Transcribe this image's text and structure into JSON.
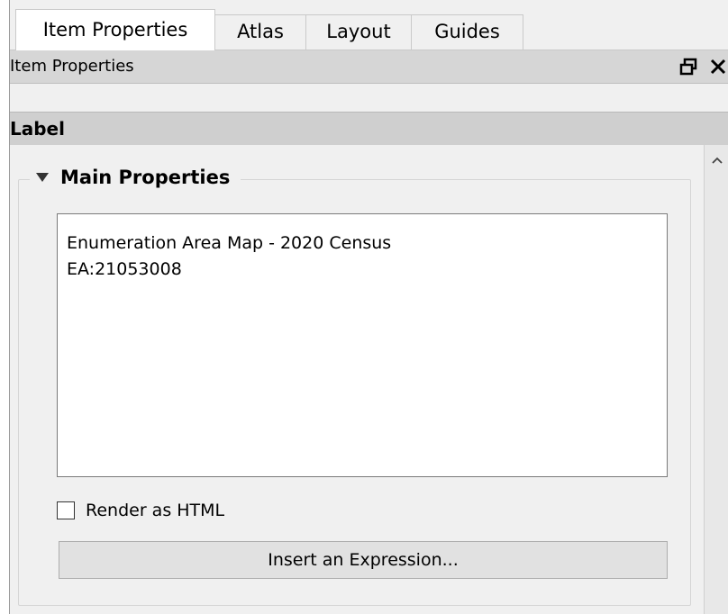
{
  "tabs": [
    {
      "label": "Item Properties",
      "active": true
    },
    {
      "label": "Atlas",
      "active": false
    },
    {
      "label": "Layout",
      "active": false
    },
    {
      "label": "Guides",
      "active": false
    }
  ],
  "dock": {
    "title": "Item Properties",
    "float_icon": "restore-window-icon",
    "close_icon": "close-icon"
  },
  "section": {
    "title": "Label"
  },
  "main_properties": {
    "title": "Main Properties",
    "collapse_icon": "triangle-down-icon",
    "label_text": "Enumeration Area Map - 2020 Census\nEA:21053008",
    "render_html_label": "Render as HTML",
    "render_html_checked": false,
    "insert_expression_label": "Insert an Expression..."
  },
  "colors": {
    "panel_bg": "#f0f0f0",
    "title_bar_bg": "#d6d6d6",
    "section_header_bg": "#cfcfcf",
    "field_bg": "#ffffff",
    "button_bg": "#e1e1e1"
  }
}
